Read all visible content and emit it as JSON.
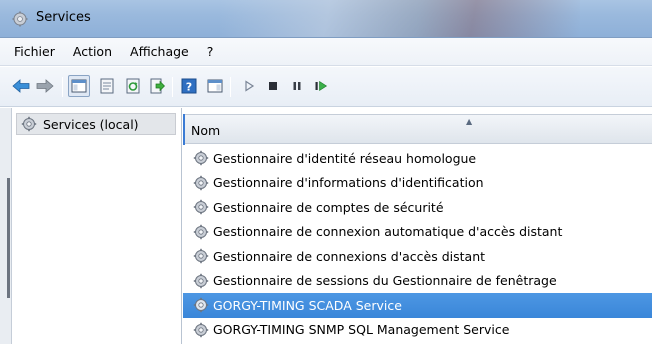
{
  "window": {
    "title": "Services"
  },
  "menu": {
    "items": [
      "Fichier",
      "Action",
      "Affichage",
      "?"
    ]
  },
  "toolbar": {
    "buttons": [
      {
        "icon": "back-arrow-icon"
      },
      {
        "icon": "forward-arrow-icon"
      },
      {
        "icon": "show-hide-console-tree-icon"
      },
      {
        "icon": "properties-icon"
      },
      {
        "icon": "refresh-icon"
      },
      {
        "icon": "export-list-icon"
      },
      {
        "icon": "help-icon"
      },
      {
        "icon": "action-pane-icon"
      },
      {
        "icon": "start-service-icon"
      },
      {
        "icon": "stop-service-icon"
      },
      {
        "icon": "pause-service-icon"
      },
      {
        "icon": "restart-service-icon"
      }
    ]
  },
  "tree": {
    "root_label": "Services (local)"
  },
  "list": {
    "column_name": "Nom",
    "rows": [
      "Gestionnaire d'identité réseau homologue",
      "Gestionnaire d'informations d'identification",
      "Gestionnaire de comptes de sécurité",
      "Gestionnaire de connexion automatique d'accès distant",
      "Gestionnaire de connexions d'accès distant",
      "Gestionnaire de sessions du Gestionnaire de fenêtrage",
      "GORGY-TIMING SCADA Service",
      "GORGY-TIMING SNMP SQL Management Service"
    ],
    "selected_index": 6
  },
  "colors": {
    "selection": "#3a86d9",
    "title_bar": "#9ab9dd"
  }
}
